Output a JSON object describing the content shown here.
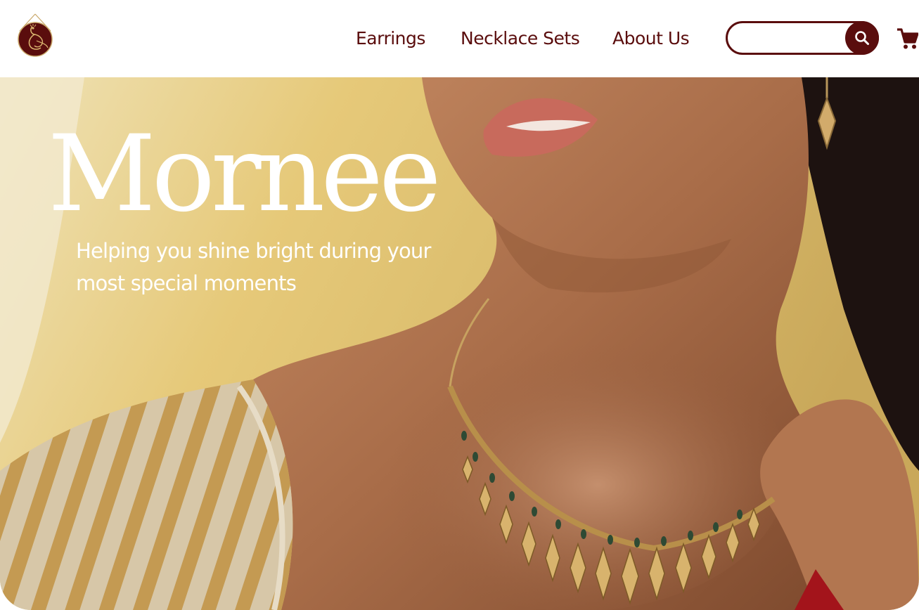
{
  "header": {
    "logo_icon": "peacock-logo-icon",
    "nav": [
      {
        "label": "Earrings"
      },
      {
        "label": "Necklace Sets"
      },
      {
        "label": "About Us"
      }
    ],
    "search": {
      "value": "",
      "placeholder": "",
      "icon": "search-icon"
    },
    "cart_icon": "cart-icon"
  },
  "hero": {
    "title": "Mornee",
    "tagline": "Helping you shine bright during your most special moments",
    "image": "woman-wearing-gold-necklace-photo"
  },
  "colors": {
    "brand_maroon": "#5a0d0d",
    "hero_text": "#ffffff",
    "background_gold": "#e8c878"
  }
}
